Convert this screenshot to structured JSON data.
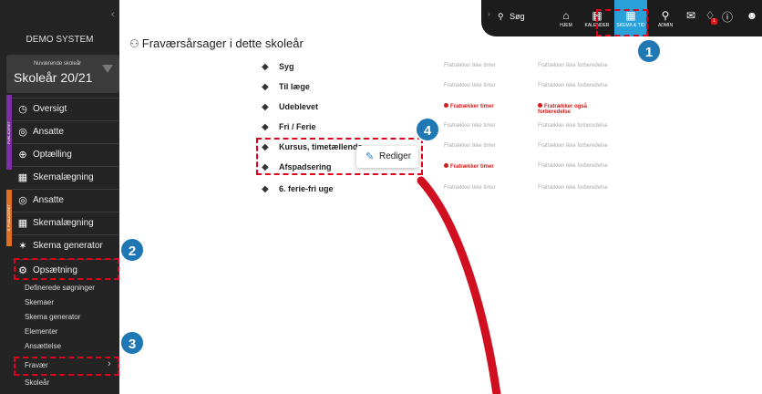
{
  "sidebar": {
    "title": "DEMO SYSTEM",
    "year_label": "Nuværende skoleår",
    "year_value": "Skoleår 20/21",
    "strip_labels": [
      "PUBLICERET",
      "E.PUBLICERET"
    ],
    "group1": [
      {
        "icon": "◷",
        "label": "Oversigt"
      },
      {
        "icon": "◎",
        "label": "Ansatte"
      },
      {
        "icon": "⊕",
        "label": "Optælling"
      },
      {
        "icon": "▦",
        "label": "Skemalægning"
      }
    ],
    "group2": [
      {
        "icon": "◎",
        "label": "Ansatte"
      },
      {
        "icon": "▦",
        "label": "Skemalægning"
      },
      {
        "icon": "✶",
        "label": "Skema generator"
      },
      {
        "icon": "⚙",
        "label": "Opsætning"
      }
    ],
    "subitems": [
      "Definerede søgninger",
      "Skemaer",
      "Skema generator",
      "Elementer",
      "Ansættelse",
      "Fravær",
      "Skoleår"
    ]
  },
  "topbar": {
    "search_label": "Søg",
    "items": [
      {
        "icon": "⌂",
        "label": "HJEM"
      },
      {
        "icon": "▦",
        "label": "KALENDER"
      },
      {
        "icon": "▦",
        "label": "SKEMA & TID"
      },
      {
        "icon": "⚲",
        "label": "ADMIN"
      }
    ],
    "notification_count": "1"
  },
  "page_title": "Fraværsårsager i dette skoleår",
  "rows": [
    {
      "name": "Syg",
      "c1": "Fratrækker ikke timer",
      "c2": "Fratrækker ikke forberedelse"
    },
    {
      "name": "Til læge",
      "c1": "Fratrækker ikke timer",
      "c2": "Fratrækker ikke forberedelse"
    },
    {
      "name": "Udeblevet",
      "c1": "Fratrækker timer",
      "c2a": "Fratrækker også",
      "c2b": "forberedelse"
    },
    {
      "name": "Fri / Ferie",
      "c1": "Fratrækker ikke timer",
      "c2": "Fratrækker ikke forberedelse"
    },
    {
      "name": "Kursus, timetællende",
      "c1": "Fratrækker ikke timer",
      "c2": "Fratrækker ikke forberedelse"
    },
    {
      "name": "Afspadsering",
      "c1": "Fratrækker timer",
      "c2": "Fratrækker ikke forberedelse"
    },
    {
      "name": "6. ferie-fri uge",
      "c1": "Fratrækker ikke timer",
      "c2": "Fratrækker ikke forberedelse"
    }
  ],
  "edit_button": "Rediger",
  "badges": [
    "1",
    "2",
    "3",
    "4"
  ],
  "colors": {
    "annotation_red": "#e0001b",
    "badge_blue": "#1f77b4",
    "accent_blue": "#2aa0d8",
    "strip_purple": "#7b2fa1",
    "strip_orange": "#e07020"
  }
}
